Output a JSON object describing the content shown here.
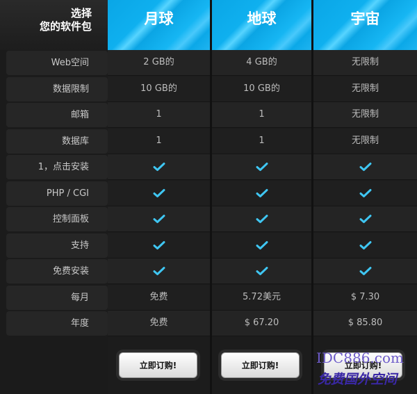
{
  "header": {
    "title_line1": "选择",
    "title_line2": "您的软件包",
    "plans": [
      "月球",
      "地球",
      "宇宙"
    ]
  },
  "rows": [
    {
      "label": "Web空间",
      "values": [
        "2 GB的",
        "4 GB的",
        "无限制"
      ]
    },
    {
      "label": "数据限制",
      "values": [
        "10 GB的",
        "10 GB的",
        "无限制"
      ]
    },
    {
      "label": "邮箱",
      "values": [
        "1",
        "1",
        "无限制"
      ]
    },
    {
      "label": "数据库",
      "values": [
        "1",
        "1",
        "无限制"
      ]
    },
    {
      "label": "1，点击安装",
      "values": [
        "check",
        "check",
        "check"
      ]
    },
    {
      "label": "PHP / CGI",
      "values": [
        "check",
        "check",
        "check"
      ]
    },
    {
      "label": "控制面板",
      "values": [
        "check",
        "check",
        "check"
      ]
    },
    {
      "label": "支持",
      "values": [
        "check",
        "check",
        "check"
      ]
    },
    {
      "label": "免费安装",
      "values": [
        "check",
        "check",
        "check"
      ]
    },
    {
      "label": "每月",
      "values": [
        "免费",
        "5.72美元",
        "$ 7.30"
      ]
    },
    {
      "label": "年度",
      "values": [
        "免费",
        "$ 67.20",
        "$ 85.80"
      ]
    }
  ],
  "footer": {
    "order_label": "立即订购!"
  },
  "watermark": {
    "line1": "IDC886.com",
    "line2": "免费国外空间"
  },
  "colors": {
    "check": "#3fc6f2",
    "header_blue": "#0aa6e6"
  },
  "icons": {
    "check": "check-icon"
  }
}
